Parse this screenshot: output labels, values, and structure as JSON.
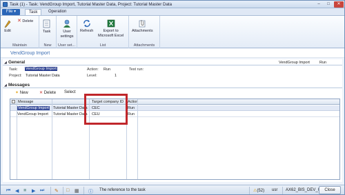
{
  "window": {
    "title": "Task (1) - Task: VendGroup Import, Tutorial Master Data, Project: Tutorial Master Data"
  },
  "ribbon": {
    "file_label": "File",
    "tabs": [
      "Task",
      "Operation"
    ],
    "groups": {
      "maintain": {
        "label": "Maintain",
        "edit": "Edit",
        "delete": "Delete"
      },
      "new": {
        "label": "New",
        "task": "Task"
      },
      "user_setup": {
        "label": "User set...",
        "user_settings": "User settings"
      },
      "list": {
        "label": "List",
        "refresh": "Refresh",
        "export_line1": "Export to",
        "export_line2": "Microsoft Excel"
      },
      "attachments": {
        "label": "Attachments",
        "attachments": "Attachments"
      }
    }
  },
  "form": {
    "title": "VendGroup Import",
    "right_caption": "VendGroup Import",
    "right_status": "Run"
  },
  "general": {
    "heading": "General",
    "task_label": "Task:",
    "task_value": "VendGroup Import",
    "project_label": "Project:",
    "project_value": "Tutorial Master Data",
    "action_label": "Action:",
    "action_value": "Run",
    "level_label": "Level:",
    "level_value": "1",
    "testrun_label": "Test run:"
  },
  "messages": {
    "heading": "Messages",
    "toolbar": {
      "new": "New",
      "delete": "Delete",
      "select": "Select"
    },
    "columns": [
      "Message",
      "",
      "",
      "Target company ID",
      "Action"
    ],
    "rows": [
      [
        "VendGroup Import",
        "Tutorial Master Data",
        "",
        "CEC",
        "Run"
      ],
      [
        "VendGroup Import",
        "Tutorial Master Data",
        "",
        "CEU",
        "Run"
      ]
    ]
  },
  "statusbar": {
    "message": "The reference to the task",
    "count": "(52)",
    "company": "usr",
    "server": "AX62_BIS_DEV_01",
    "close": "Close"
  },
  "colors": {
    "accent": "#2a66b8",
    "selection": "#2b3f8f",
    "annotation_box": "#c0262b"
  }
}
